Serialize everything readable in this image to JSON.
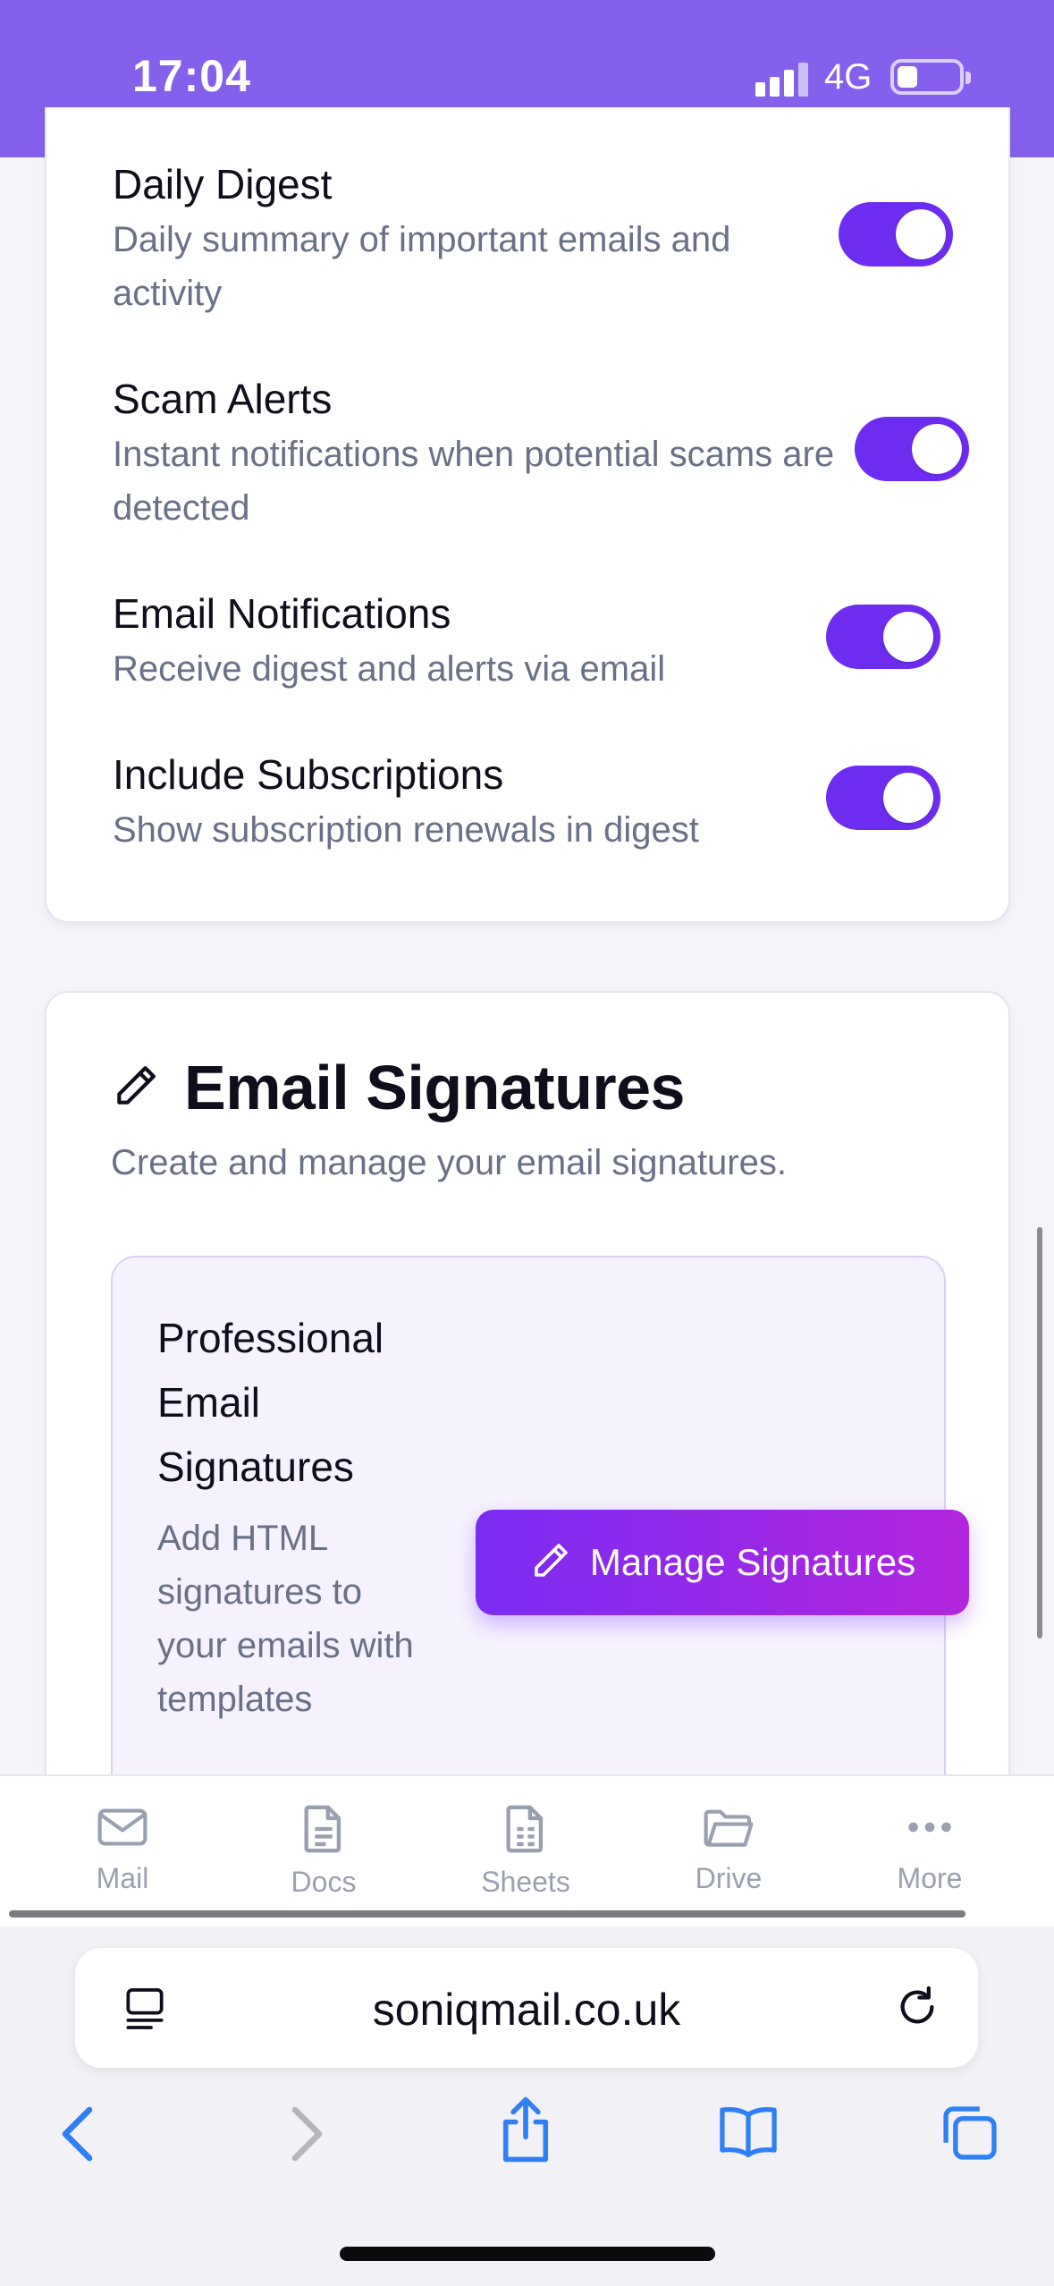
{
  "status_bar": {
    "time": "17:04",
    "network": "4G"
  },
  "notifications": [
    {
      "title": "Daily Digest",
      "description": "Daily summary of important emails and activity",
      "enabled": true
    },
    {
      "title": "Scam Alerts",
      "description": "Instant notifications when potential scams are detected",
      "enabled": true
    },
    {
      "title": "Email Notifications",
      "description": "Receive digest and alerts via email",
      "enabled": true
    },
    {
      "title": "Include Subscriptions",
      "description": "Show subscription renewals in digest",
      "enabled": true
    }
  ],
  "signatures": {
    "title": "Email Signatures",
    "subtitle": "Create and manage your email signatures.",
    "box_title": "Professional Email Signatures",
    "box_description": "Add HTML signatures to your emails with templates",
    "button_label": "Manage Signatures"
  },
  "app_nav": [
    {
      "label": "Mail",
      "icon": "mail-icon"
    },
    {
      "label": "Docs",
      "icon": "doc-icon"
    },
    {
      "label": "Sheets",
      "icon": "sheet-icon"
    },
    {
      "label": "Drive",
      "icon": "folder-icon"
    },
    {
      "label": "More",
      "icon": "more-icon"
    }
  ],
  "browser": {
    "url": "soniqmail.co.uk"
  },
  "colors": {
    "accent": "#6d2cf0",
    "status_bar": "#8560ec",
    "ios_blue": "#2f7ff5"
  }
}
